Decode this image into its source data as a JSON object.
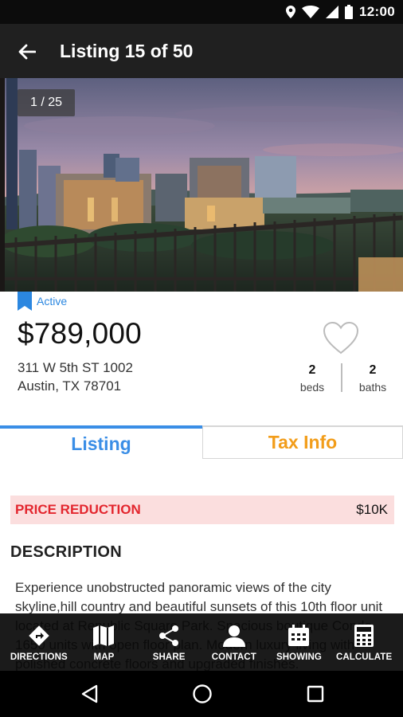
{
  "status_bar": {
    "time": "12:00",
    "icons": [
      "location-icon",
      "wifi-icon",
      "signal-icon",
      "battery-icon"
    ]
  },
  "app_bar": {
    "title": "Listing 15 of 50",
    "back_icon": "arrow-back-icon"
  },
  "photo": {
    "counter": "1 / 25"
  },
  "listing": {
    "status": "Active",
    "price": "$789,000",
    "address_line1": "311 W 5th ST 1002",
    "address_line2": "Austin, TX 78701",
    "beds_value": "2",
    "beds_label": "beds",
    "baths_value": "2",
    "baths_label": "baths"
  },
  "tabs": [
    {
      "label": "Listing",
      "active": true
    },
    {
      "label": "Tax Info",
      "active": false
    }
  ],
  "price_reduction": {
    "label": "PRICE REDUCTION",
    "value": "$10K"
  },
  "description": {
    "title": "DESCRIPTION",
    "text": "Experience unobstructed panoramic views of the city skyline,hill country and beautiful sunsets of this 10th floor unit located at Republic Square Park. Spacious boutique Condo 1650 units with open floor plan. Modern luxury living with polished concrete floors and upgraded finishes."
  },
  "toolbar": [
    {
      "label": "DIRECTIONS",
      "icon": "directions-icon"
    },
    {
      "label": "MAP",
      "icon": "map-icon"
    },
    {
      "label": "SHARE",
      "icon": "share-icon"
    },
    {
      "label": "CONTACT",
      "icon": "contact-icon"
    },
    {
      "label": "SHOWING",
      "icon": "calendar-icon"
    },
    {
      "label": "CALCULATE",
      "icon": "calculator-icon"
    }
  ],
  "nav": [
    "back-nav-icon",
    "home-nav-icon",
    "recents-nav-icon"
  ],
  "colors": {
    "accent_blue": "#3a8ee6",
    "tax_orange": "#f29d1a",
    "reduction_red": "#e3262e",
    "reduction_bg": "#fbdede",
    "app_bar": "#202020"
  }
}
